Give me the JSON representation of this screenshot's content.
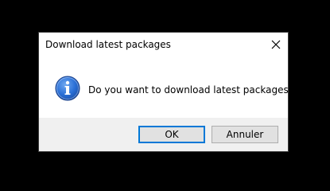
{
  "dialog": {
    "title": "Download latest packages",
    "message": "Do you want to download latest packages?",
    "icon": "information-icon",
    "ok_label": "OK",
    "cancel_label": "Annuler",
    "close_icon": "close-icon"
  },
  "colors": {
    "background": "#000000",
    "dialog_body": "#ffffff",
    "footer": "#f0f0f0",
    "default_button_border": "#0078d7",
    "icon_blue": "#1f5fbf"
  }
}
